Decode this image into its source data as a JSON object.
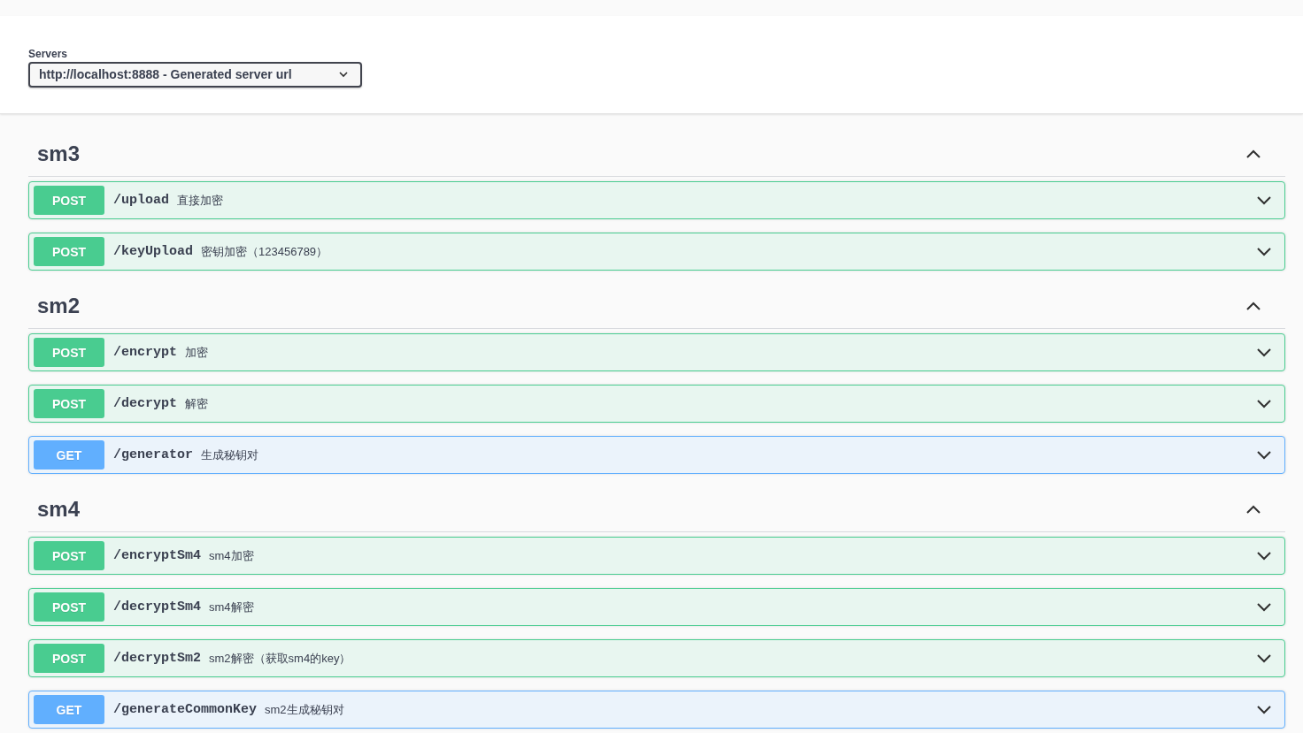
{
  "servers": {
    "label": "Servers",
    "value": "http://localhost:8888 - Generated server url"
  },
  "sections": [
    {
      "name": "sm3",
      "expanded": true,
      "operations": [
        {
          "kind": "post",
          "method": "POST",
          "path": "/upload",
          "summary": "直接加密",
          "expanded": false
        },
        {
          "kind": "post",
          "method": "POST",
          "path": "/keyUpload",
          "summary": "密钥加密（123456789）",
          "expanded": false
        }
      ]
    },
    {
      "name": "sm2",
      "expanded": true,
      "operations": [
        {
          "kind": "post",
          "method": "POST",
          "path": "/encrypt",
          "summary": "加密",
          "expanded": false
        },
        {
          "kind": "post",
          "method": "POST",
          "path": "/decrypt",
          "summary": "解密",
          "expanded": false
        },
        {
          "kind": "get",
          "method": "GET",
          "path": "/generator",
          "summary": "生成秘钥对",
          "expanded": false
        }
      ]
    },
    {
      "name": "sm4",
      "expanded": true,
      "operations": [
        {
          "kind": "post",
          "method": "POST",
          "path": "/encryptSm4",
          "summary": "sm4加密",
          "expanded": false
        },
        {
          "kind": "post",
          "method": "POST",
          "path": "/decryptSm4",
          "summary": "sm4解密",
          "expanded": false
        },
        {
          "kind": "post",
          "method": "POST",
          "path": "/decryptSm2",
          "summary": "sm2解密（获取sm4的key）",
          "expanded": false
        },
        {
          "kind": "get",
          "method": "GET",
          "path": "/generateCommonKey",
          "summary": "sm2生成秘钥对",
          "expanded": false
        }
      ]
    }
  ]
}
